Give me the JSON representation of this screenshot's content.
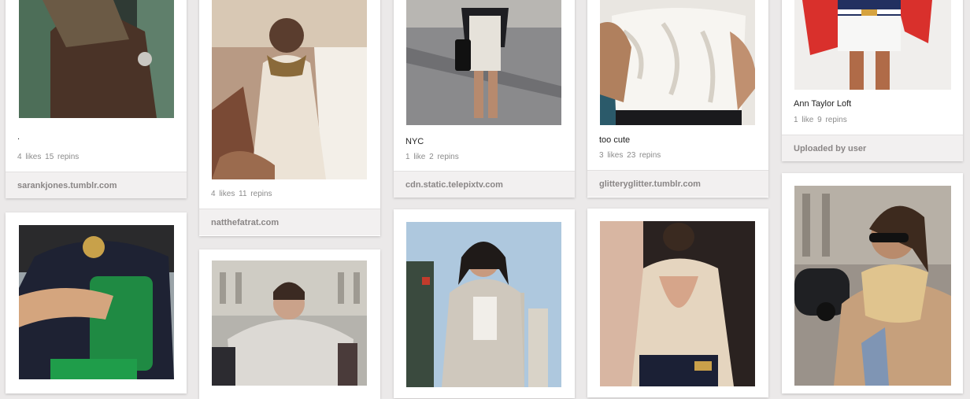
{
  "pins": [
    {
      "caption": ".",
      "likes": "4 likes",
      "repins": "15 repins",
      "source": "sarankjones.tumblr.com"
    },
    {
      "caption": "",
      "likes": "4 likes",
      "repins": "11 repins",
      "source": "natthefatrat.com"
    },
    {
      "caption": "NYC",
      "likes": "1 like",
      "repins": "2 repins",
      "source": "cdn.static.telepixtv.com"
    },
    {
      "caption": "too cute",
      "likes": "3 likes",
      "repins": "23 repins",
      "source": "glitteryglitter.tumblr.com"
    },
    {
      "caption": "Ann Taylor Loft",
      "likes": "1 like",
      "repins": "9 repins",
      "source": "Uploaded by user"
    }
  ],
  "colors": {
    "background": "#ebe9e9",
    "card": "#ffffff",
    "footer": "#f2f0f0",
    "muted_text": "#8b8b8b"
  }
}
